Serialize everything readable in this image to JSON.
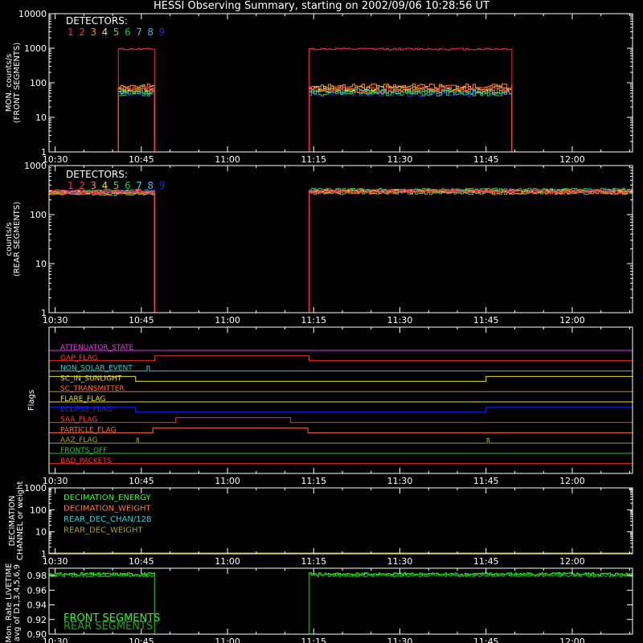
{
  "title": "HESSI Observing Summary, starting on 2002/09/06 10:28:56 UT",
  "colors": {
    "background": "#000000",
    "axes": "#ffffff",
    "det": [
      "#ff2060",
      "#ff3030",
      "#ff8c1a",
      "#e8e020",
      "#80c020",
      "#20c040",
      "#20d0c0",
      "#40b0ff",
      "#2020ff"
    ]
  },
  "x_axis": {
    "tick_labels": [
      "10:30",
      "10:45",
      "11:00",
      "11:15",
      "11:30",
      "11:45",
      "12:00"
    ],
    "ticks_min": [
      30,
      45,
      60,
      75,
      90,
      105,
      120
    ],
    "range_min": [
      28.933,
      130.5
    ]
  },
  "chart_data": [
    {
      "panel": "front",
      "type": "line",
      "ylabel": [
        "MON. counts/s",
        "(FRONT SEGMENTS)"
      ],
      "ylog": true,
      "ylim": [
        1,
        10000
      ],
      "ytick_labels": [
        "1",
        "10",
        "100",
        "1000",
        "10000"
      ],
      "ytick_values": [
        1,
        10,
        100,
        1000,
        10000
      ],
      "legend_title": "DETECTORS:",
      "legend_items": [
        "1",
        "2",
        "3",
        "4",
        "5",
        "6",
        "7",
        "8",
        "9"
      ],
      "intervals_min": [
        [
          41.0,
          47.3
        ],
        [
          74.2,
          109.5
        ]
      ],
      "series": [
        {
          "name": "1",
          "level": 950,
          "rise_from": 700
        },
        {
          "name": "2",
          "level": 65
        },
        {
          "name": "3",
          "level": 80
        },
        {
          "name": "4",
          "level": 70
        },
        {
          "name": "5",
          "level": 60
        },
        {
          "name": "6",
          "level": 50
        },
        {
          "name": "7",
          "level": 58
        },
        {
          "name": "8",
          "level": 55
        },
        {
          "name": "9",
          "level": 48
        }
      ]
    },
    {
      "panel": "rear",
      "type": "line",
      "ylabel": [
        "counts/s",
        "(REAR SEGMENTS)"
      ],
      "ylog": true,
      "ylim": [
        1,
        1000
      ],
      "ytick_labels": [
        "1",
        "10",
        "100",
        "1000"
      ],
      "ytick_values": [
        1,
        10,
        100,
        1000
      ],
      "legend_title": "DETECTORS:",
      "legend_items": [
        "1",
        "2",
        "3",
        "4",
        "5",
        "6",
        "7",
        "8",
        "9"
      ],
      "intervals_min": [
        [
          28.933,
          47.3
        ],
        [
          74.2,
          130.5
        ]
      ],
      "levels": [
        280,
        300,
        270,
        290,
        260,
        310,
        295,
        285,
        300
      ]
    },
    {
      "panel": "flags",
      "type": "step",
      "ylabel": "Flags",
      "flags": [
        {
          "name": "ATTENUATOR_STATE",
          "color": "#e040e0",
          "pulses": []
        },
        {
          "name": "GAP_FLAG",
          "color": "#ff3030",
          "pulses": [
            [
              47.3,
              74.2
            ]
          ]
        },
        {
          "name": "NON_SOLAR_EVENT",
          "color": "#20d0d0",
          "pulses": [
            [
              46.0,
              46.4
            ]
          ]
        },
        {
          "name": "SC_IN_SUNLIGHT",
          "color": "#e8e020",
          "pulses": [
            [
              28.933,
              44.0
            ],
            [
              105.0,
              130.5
            ]
          ],
          "invert": true
        },
        {
          "name": "SC_TRANSMITTER",
          "color": "#ff6a2a",
          "pulses": []
        },
        {
          "name": "FLARE_FLAG",
          "color": "#e8e020",
          "pulses": []
        },
        {
          "name": "ECLIPSE_FLAG",
          "color": "#2020ff",
          "pulses": [
            [
              28.933,
              44.0
            ],
            [
              105.0,
              130.5
            ]
          ]
        },
        {
          "name": "SAA_FLAG",
          "color": "#ff3030",
          "pulses": [
            [
              51.0,
              71.0
            ]
          ]
        },
        {
          "name": "PARTICLE_FLAG",
          "color": "#ff6a2a",
          "pulses": [
            [
              47.0,
              74.0
            ]
          ]
        },
        {
          "name": "AAZ_FLAG",
          "color": "#a0a020",
          "pulses": [
            [
              44.2,
              44.5
            ],
            [
              105.2,
              105.5
            ]
          ]
        },
        {
          "name": "FRONTS_OFF",
          "color": "#20c040",
          "pulses": []
        },
        {
          "name": "BAD_PACKETS",
          "color": "#ff3030",
          "pulses": []
        }
      ]
    },
    {
      "panel": "decimation",
      "type": "line",
      "ylabel": [
        "DECIMATION",
        "CHANNEL or weight"
      ],
      "ylog": true,
      "ylim": [
        1,
        1000
      ],
      "ytick_labels": [
        "1",
        "10",
        "100",
        "1000"
      ],
      "ytick_values": [
        1,
        10,
        100,
        1000
      ],
      "legend": [
        {
          "name": "DECIMATION_ENERGY",
          "color": "#20ff20"
        },
        {
          "name": "DECIMATION_WEIGHT",
          "color": "#ff7a2a"
        },
        {
          "name": "REAR_DEC_CHAN/128",
          "color": "#20d0d0"
        },
        {
          "name": "REAR_DEC_WEIGHT",
          "color": "#a0a020"
        }
      ],
      "baseline": 1
    },
    {
      "panel": "livetime",
      "type": "line",
      "ylabel": [
        "Mon. Rate LIVETIME",
        "avg of D1,3,4,5,6,9"
      ],
      "ylim": [
        0.9,
        0.99
      ],
      "ytick_labels": [
        "0.90",
        "0.92",
        "0.94",
        "0.96",
        "0.98"
      ],
      "ytick_values": [
        0.9,
        0.92,
        0.94,
        0.96,
        0.98
      ],
      "series": [
        {
          "name": "FRONT SEGMENTS",
          "color": "#20ff20",
          "level": 0.982
        },
        {
          "name": "REAR SEGMENTS",
          "color": "#20a020",
          "level": 0.98
        }
      ],
      "intervals_min": [
        [
          28.933,
          47.3
        ],
        [
          74.2,
          130.5
        ]
      ]
    }
  ]
}
